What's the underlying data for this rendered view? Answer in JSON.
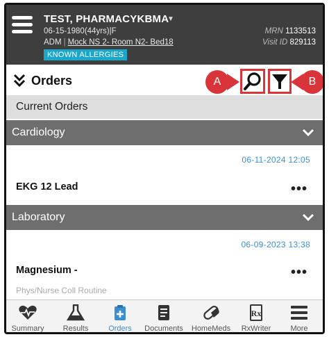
{
  "patient": {
    "name": "TEST, PHARMACYKBMA",
    "dob_line": "06-15-1980(44yrs)|F",
    "encounter_type": "ADM",
    "location": "Mock NS 2- Room N2- Bed18",
    "allergy_badge": "KNOWN ALLERGIES",
    "mrn_label": "MRN",
    "mrn_value": "1133513",
    "visit_label": "Visit ID",
    "visit_value": "829113"
  },
  "orders_bar": {
    "title": "Orders",
    "callout_a": "A",
    "callout_b": "B"
  },
  "current_orders_label": "Current Orders",
  "sections": [
    {
      "name": "Cardiology",
      "orders": [
        {
          "date": "06-11-2024 12:05",
          "name": "EKG 12 Lead",
          "more": "•••"
        }
      ]
    },
    {
      "name": "Laboratory",
      "orders": [
        {
          "date": "06-09-2023 13:38",
          "name": "Magnesium -",
          "detail": "Phys/Nurse Coll Routine",
          "more": "•••"
        }
      ]
    }
  ],
  "tabs": [
    {
      "label": "Summary",
      "icon": "heart-pulse-icon"
    },
    {
      "label": "Results",
      "icon": "flask-icon"
    },
    {
      "label": "Orders",
      "icon": "clipboard-plus-icon",
      "active": true
    },
    {
      "label": "Documents",
      "icon": "document-icon"
    },
    {
      "label": "HomeMeds",
      "icon": "pill-icon"
    },
    {
      "label": "RxWriter",
      "icon": "rx-icon"
    },
    {
      "label": "More",
      "icon": "menu-icon"
    }
  ],
  "colors": {
    "header_bg": "#3e3e3e",
    "allergy_badge": "#1aa7c9",
    "section_header": "#6e6e6e",
    "date_blue": "#3a8fd2",
    "callout_red": "#d9343a"
  }
}
